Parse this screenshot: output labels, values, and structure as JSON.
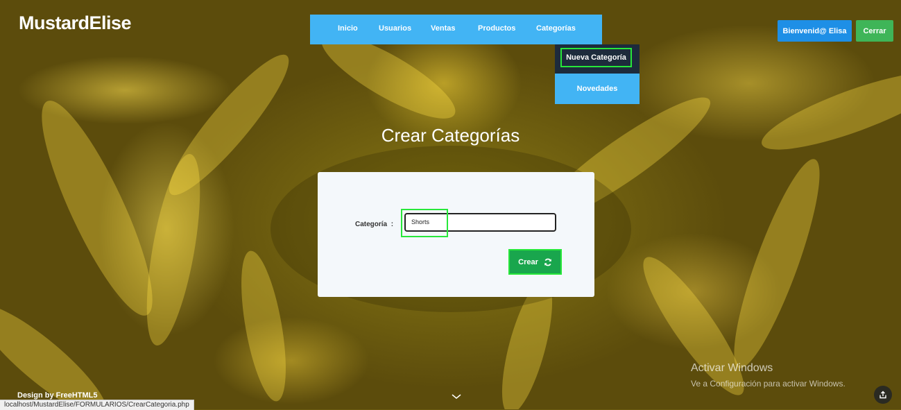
{
  "header": {
    "brand": "MustardElise",
    "nav": [
      {
        "label": "Inicio"
      },
      {
        "label": "Usuarios"
      },
      {
        "label": "Ventas"
      },
      {
        "label": "Productos"
      },
      {
        "label": "Categorías"
      }
    ],
    "dropdown": {
      "items": [
        {
          "label": "Nueva Categoría",
          "highlighted": true
        },
        {
          "label": "Novedades"
        }
      ]
    },
    "welcome_label": "Bienvenid@ Elisa",
    "logout_label": "Cerrar"
  },
  "main": {
    "title": "Crear Categorías",
    "form": {
      "field_label": "Categoría",
      "field_separator": ":",
      "field_value": "Shorts",
      "submit_label": "Crear"
    }
  },
  "footer": {
    "design_by": "Design by FreeHTML5",
    "status_url": "localhost/MustardElise/FORMULARIOS/CrearCategoria.php"
  },
  "watermark": {
    "title": "Activar Windows",
    "subtitle": "Ve a Configuración para activar Windows."
  },
  "colors": {
    "nav_bg": "#42b4f4",
    "welcome_btn": "#1e8fe6",
    "logout_btn": "#3fb558",
    "submit_btn": "#19a64d",
    "highlight": "#27e83a",
    "dropdown_dark": "#1d2b3c"
  },
  "icons": {
    "submit": "refresh-icon",
    "scroll": "chevron-down-icon",
    "share": "share-icon"
  }
}
